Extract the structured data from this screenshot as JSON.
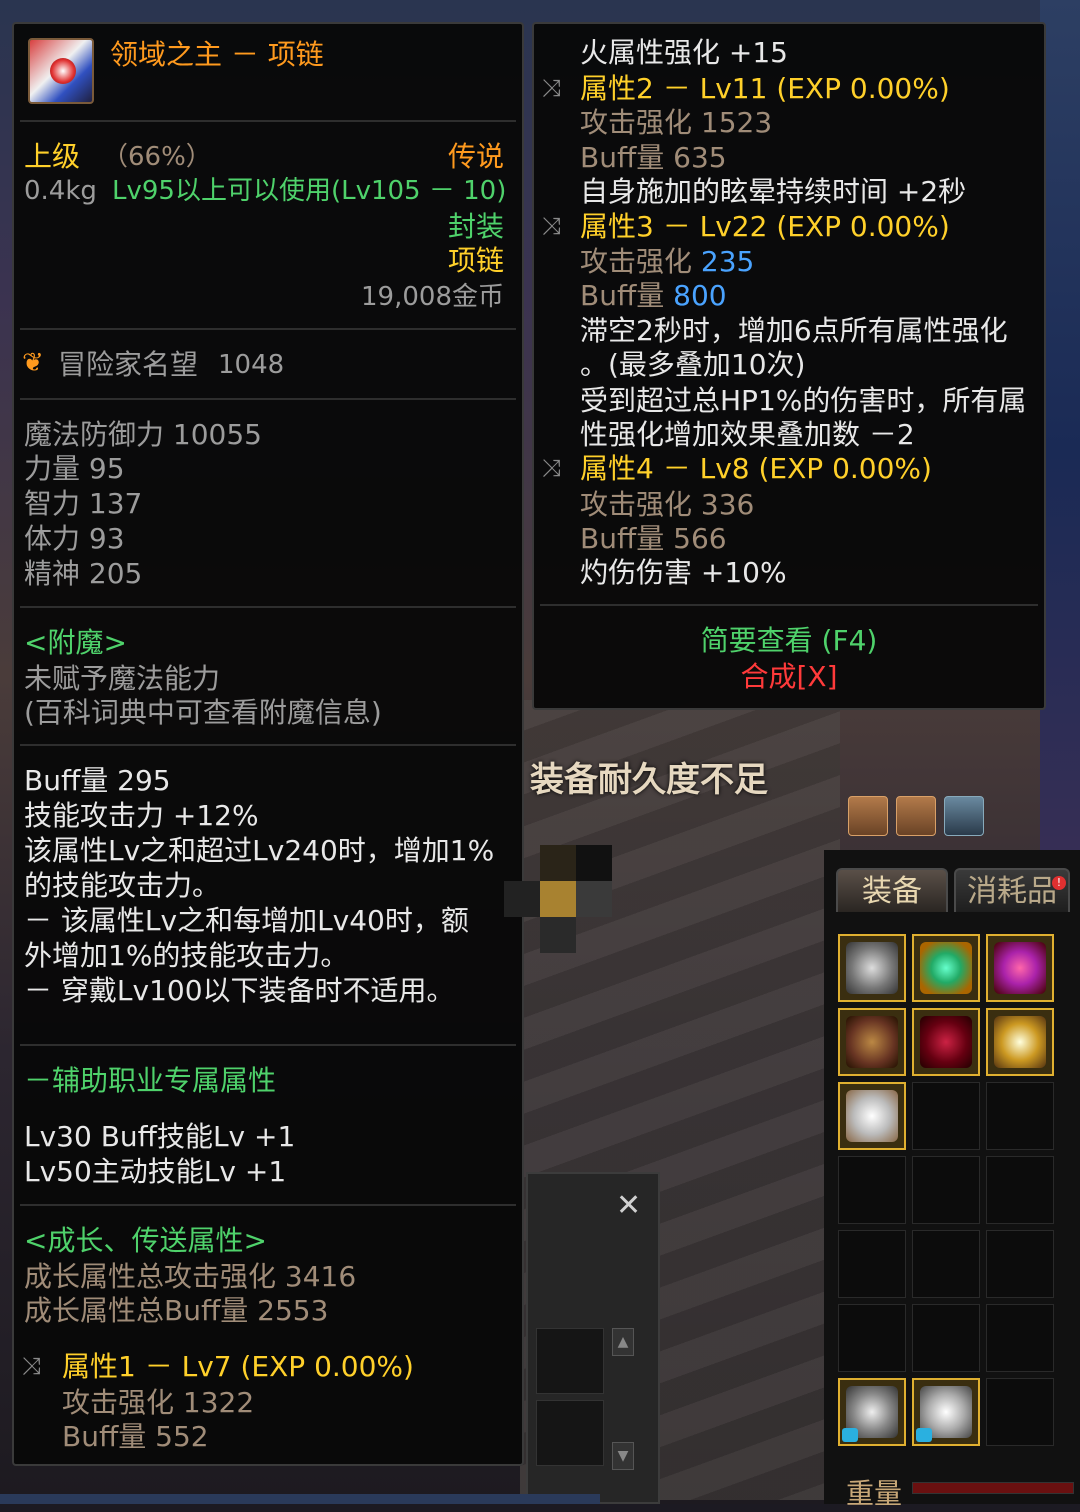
{
  "item": {
    "name": "领域之主 － 项链",
    "grade": "上级",
    "grade_pct": "（66%）",
    "rarity": "传说",
    "weight": "0.4kg",
    "requirement": "Lv95以上可以使用(Lv105 － 10)",
    "sealed": "封装",
    "type": "项链",
    "price": "19,008金币"
  },
  "reputation": {
    "label": "冒险家名望",
    "value": "1048"
  },
  "base_stats": [
    {
      "name": "魔法防御力",
      "value": "10055"
    },
    {
      "name": "力量",
      "value": "95"
    },
    {
      "name": "智力",
      "value": "137"
    },
    {
      "name": "体力",
      "value": "93"
    },
    {
      "name": "精神",
      "value": "205"
    }
  ],
  "enchant": {
    "title": "<附魔>",
    "line1": "未赋予魔法能力",
    "line2": "(百科词典中可查看附魔信息)"
  },
  "effects": [
    "Buff量 295",
    "技能攻击力 +12%",
    "该属性Lv之和超过Lv240时，增加1%",
    "的技能攻击力。",
    "－ 该属性Lv之和每增加Lv40时，额",
    "外增加1%的技能攻击力。",
    "－ 穿戴Lv100以下装备时不适用。"
  ],
  "support": {
    "title": "－辅助职业专属属性",
    "line1": "Lv30 Buff技能Lv +1",
    "line2": "Lv50主动技能Lv +1"
  },
  "growth": {
    "title": "<成长、传送属性>",
    "total_attack": "成长属性总攻击强化 3416",
    "total_buff": "成长属性总Buff量 2553"
  },
  "attr1": {
    "title": "属性1 － Lv7 (EXP 0.00%)",
    "atk": "攻击强化 1322",
    "buff": "Buff量 552"
  },
  "right": {
    "top_line": "火属性强化 +15",
    "attr2": {
      "title": "属性2 － Lv11 (EXP 0.00%)",
      "atk": "攻击强化 1523",
      "buff": "Buff量 635",
      "extra": "自身施加的眩晕持续时间 +2秒"
    },
    "attr3": {
      "title": "属性3 － Lv22 (EXP 0.00%)",
      "atk_label": "攻击强化",
      "atk_value": "235",
      "buff_label": "Buff量",
      "buff_value": "800",
      "extra1": "滞空2秒时，增加6点所有属性强化",
      "extra2": "。(最多叠加10次)",
      "extra3": "受到超过总HP1%的伤害时，所有属",
      "extra4": "性强化增加效果叠加数 －2"
    },
    "attr4": {
      "title": "属性4 － Lv8 (EXP 0.00%)",
      "atk": "攻击强化 336",
      "buff": "Buff量 566",
      "extra": "灼伤伤害 +10%"
    },
    "brief": "简要查看 (F4)",
    "synth": "合成[X]"
  },
  "warning": "装备耐久度不足",
  "inventory": {
    "tabs": [
      "装备",
      "消耗品"
    ],
    "weight_label": "重量"
  },
  "colors": {
    "orange": "#ff9a1e",
    "green": "#4fd26b",
    "blue": "#4aa3ff",
    "red": "#ff3a3a"
  }
}
